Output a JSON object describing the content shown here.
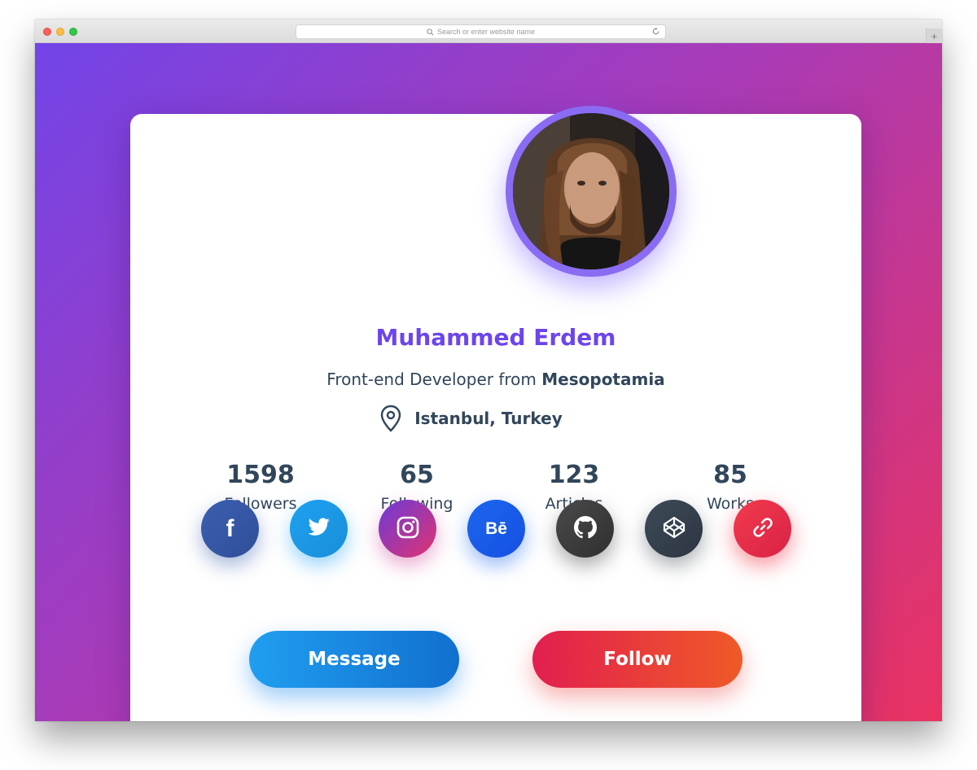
{
  "browser": {
    "address_placeholder": "Search or enter website name",
    "new_tab_label": "+"
  },
  "profile": {
    "name": "Muhammed Erdem",
    "title_prefix": "Front-end Developer from ",
    "title_place": "Mesopotamia",
    "location": "Istanbul, Turkey",
    "avatar_icon": "user-photo"
  },
  "stats": [
    {
      "value": "1598",
      "label": "Followers"
    },
    {
      "value": "65",
      "label": "Following"
    },
    {
      "value": "123",
      "label": "Articles"
    },
    {
      "value": "85",
      "label": "Works"
    }
  ],
  "socials": [
    {
      "icon": "facebook-icon",
      "glyph": "f",
      "color_from": "#3b5fb0",
      "color_to": "#2f4e99"
    },
    {
      "icon": "twitter-icon",
      "glyph": "",
      "color_from": "#1da1f2",
      "color_to": "#1a8ed8"
    },
    {
      "icon": "instagram-icon",
      "glyph": "",
      "color_from": "#6a3bd8",
      "color_to": "#e2336f"
    },
    {
      "icon": "behance-icon",
      "glyph": "Bē",
      "color_from": "#1b67f0",
      "color_to": "#174fe0"
    },
    {
      "icon": "github-icon",
      "glyph": "",
      "color_from": "#4a4a4a",
      "color_to": "#2f2f2f"
    },
    {
      "icon": "codepen-icon",
      "glyph": "",
      "color_from": "#3e4a58",
      "color_to": "#2c3642"
    },
    {
      "icon": "link-icon",
      "glyph": "",
      "color_from": "#f23a4d",
      "color_to": "#d92245"
    }
  ],
  "buttons": {
    "message": "Message",
    "follow": "Follow"
  },
  "colors": {
    "accent": "#6d45ec",
    "text": "#31465a",
    "bg_from": "#7244e8",
    "bg_to": "#ea3261"
  }
}
